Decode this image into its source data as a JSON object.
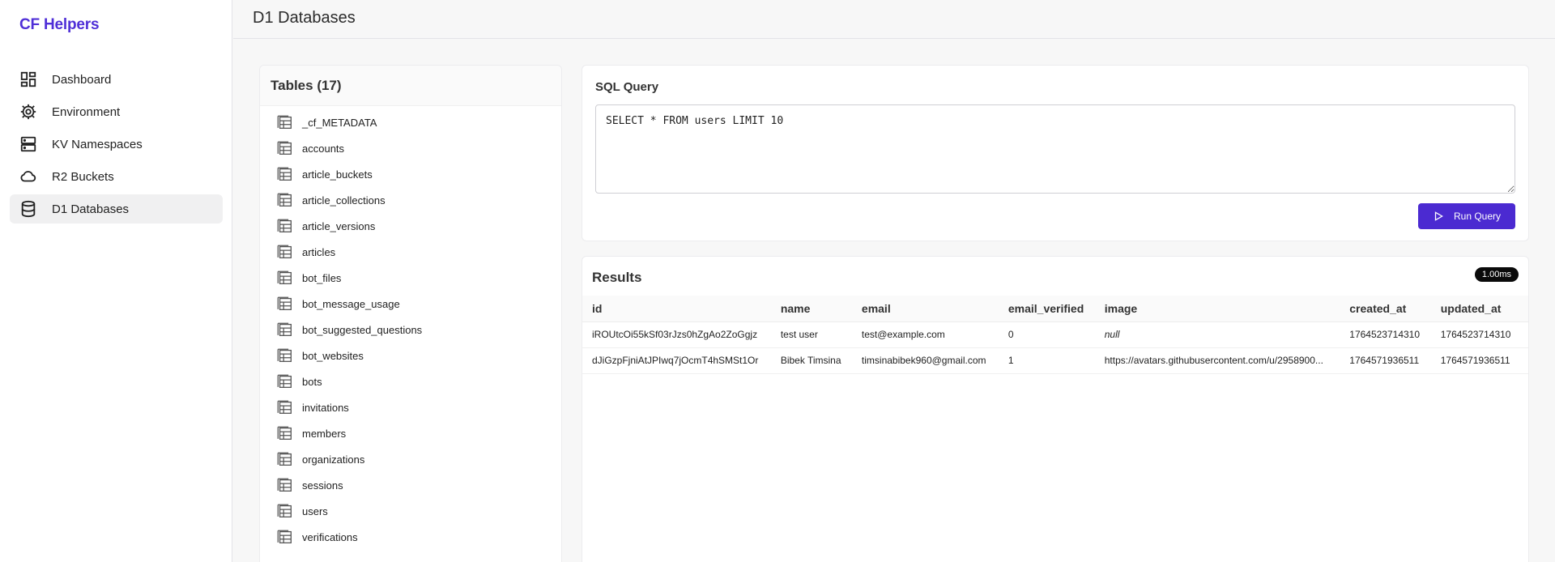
{
  "brand": "CF Helpers",
  "page_title": "D1 Databases",
  "nav": [
    {
      "label": "Dashboard",
      "icon": "dashboard-icon"
    },
    {
      "label": "Environment",
      "icon": "gear-icon"
    },
    {
      "label": "KV Namespaces",
      "icon": "server-icon"
    },
    {
      "label": "R2 Buckets",
      "icon": "cloud-icon"
    },
    {
      "label": "D1 Databases",
      "icon": "database-icon",
      "active": true
    }
  ],
  "tables": {
    "heading": "Tables (17)",
    "items": [
      "_cf_METADATA",
      "accounts",
      "article_buckets",
      "article_collections",
      "article_versions",
      "articles",
      "bot_files",
      "bot_message_usage",
      "bot_suggested_questions",
      "bot_websites",
      "bots",
      "invitations",
      "members",
      "organizations",
      "sessions",
      "users",
      "verifications"
    ]
  },
  "sql": {
    "label": "SQL Query",
    "query": "SELECT * FROM users LIMIT 10",
    "run_label": "Run Query"
  },
  "results": {
    "title": "Results",
    "timing": "1.00ms",
    "columns": [
      "id",
      "name",
      "email",
      "email_verified",
      "image",
      "created_at",
      "updated_at"
    ],
    "rows": [
      [
        "iROUtcOi55kSf03rJzs0hZgAo2ZoGgjz",
        "test user",
        "test@example.com",
        "0",
        "null",
        "1764523714310",
        "1764523714310"
      ],
      [
        "dJiGzpFjniAtJPIwq7jOcmT4hSMSt1Or",
        "Bibek Timsina",
        "timsinabibek960@gmail.com",
        "1",
        "https://avatars.githubusercontent.com/u/2958900...",
        "1764571936511",
        "1764571936511"
      ]
    ]
  },
  "colors": {
    "accent": "#4b2ad1",
    "brand": "#4f2fd7",
    "badge_bg": "#0a0a0a"
  }
}
